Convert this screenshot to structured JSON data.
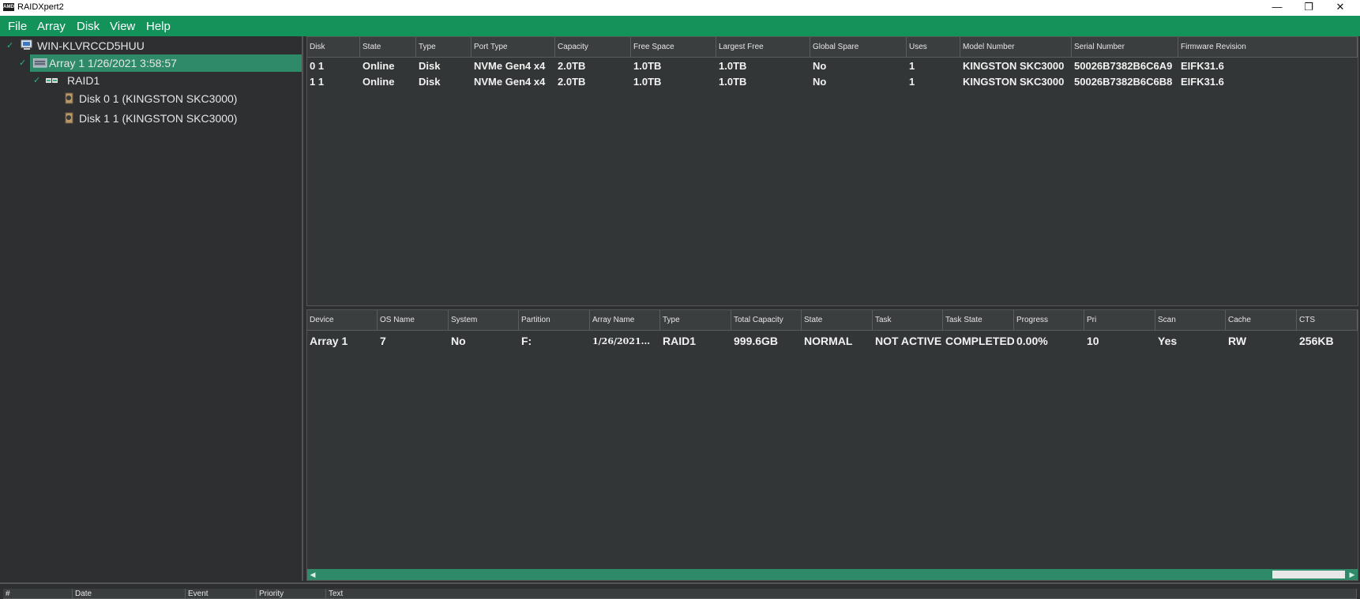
{
  "window": {
    "app_icon_text": "AMD",
    "title": "RAIDXpert2",
    "minimize": "—",
    "restore": "❐",
    "close": "✕"
  },
  "menu": [
    "File",
    "Array",
    "Disk",
    "View",
    "Help"
  ],
  "tree": {
    "computer": "WIN-KLVRCCD5HUU",
    "array": "Array 1  1/26/2021 3:58:57",
    "raid": "RAID1",
    "disks": [
      "Disk 0 1 (KINGSTON SKC3000)",
      "Disk 1 1 (KINGSTON SKC3000)"
    ]
  },
  "disk_table": {
    "headers": [
      "Disk",
      "State",
      "Type",
      "Port Type",
      "Capacity",
      "Free Space",
      "Largest Free",
      "Global Spare",
      "Uses",
      "Model Number",
      "Serial Number",
      "Firmware Revision"
    ],
    "rows": [
      [
        "0 1",
        "Online",
        "Disk",
        "NVMe Gen4 x4",
        "2.0TB",
        "1.0TB",
        "1.0TB",
        "No",
        "1",
        "KINGSTON SKC3000",
        "50026B7382B6C6A9",
        "EIFK31.6"
      ],
      [
        "1 1",
        "Online",
        "Disk",
        "NVMe Gen4 x4",
        "2.0TB",
        "1.0TB",
        "1.0TB",
        "No",
        "1",
        "KINGSTON SKC3000",
        "50026B7382B6C6B8",
        "EIFK31.6"
      ]
    ]
  },
  "array_table": {
    "headers": [
      "Device",
      "OS Name",
      "System",
      "Partition",
      "Array Name",
      "Type",
      "Total Capacity",
      "State",
      "Task",
      "Task State",
      "Progress",
      "Pri",
      "Scan",
      "Cache",
      "CTS"
    ],
    "rows": [
      [
        "Array 1",
        "7",
        "No",
        "F:",
        "1/26/2021...",
        "RAID1",
        "999.6GB",
        "NORMAL",
        "NOT ACTIVE",
        "COMPLETED",
        "0.00%",
        "10",
        "Yes",
        "RW",
        "256KB"
      ]
    ]
  },
  "scrollbar": {
    "left_arrow": "◀",
    "right_arrow": "▶"
  },
  "log_table": {
    "headers": [
      "#",
      "Date",
      "Event",
      "Priority",
      "Text"
    ]
  }
}
